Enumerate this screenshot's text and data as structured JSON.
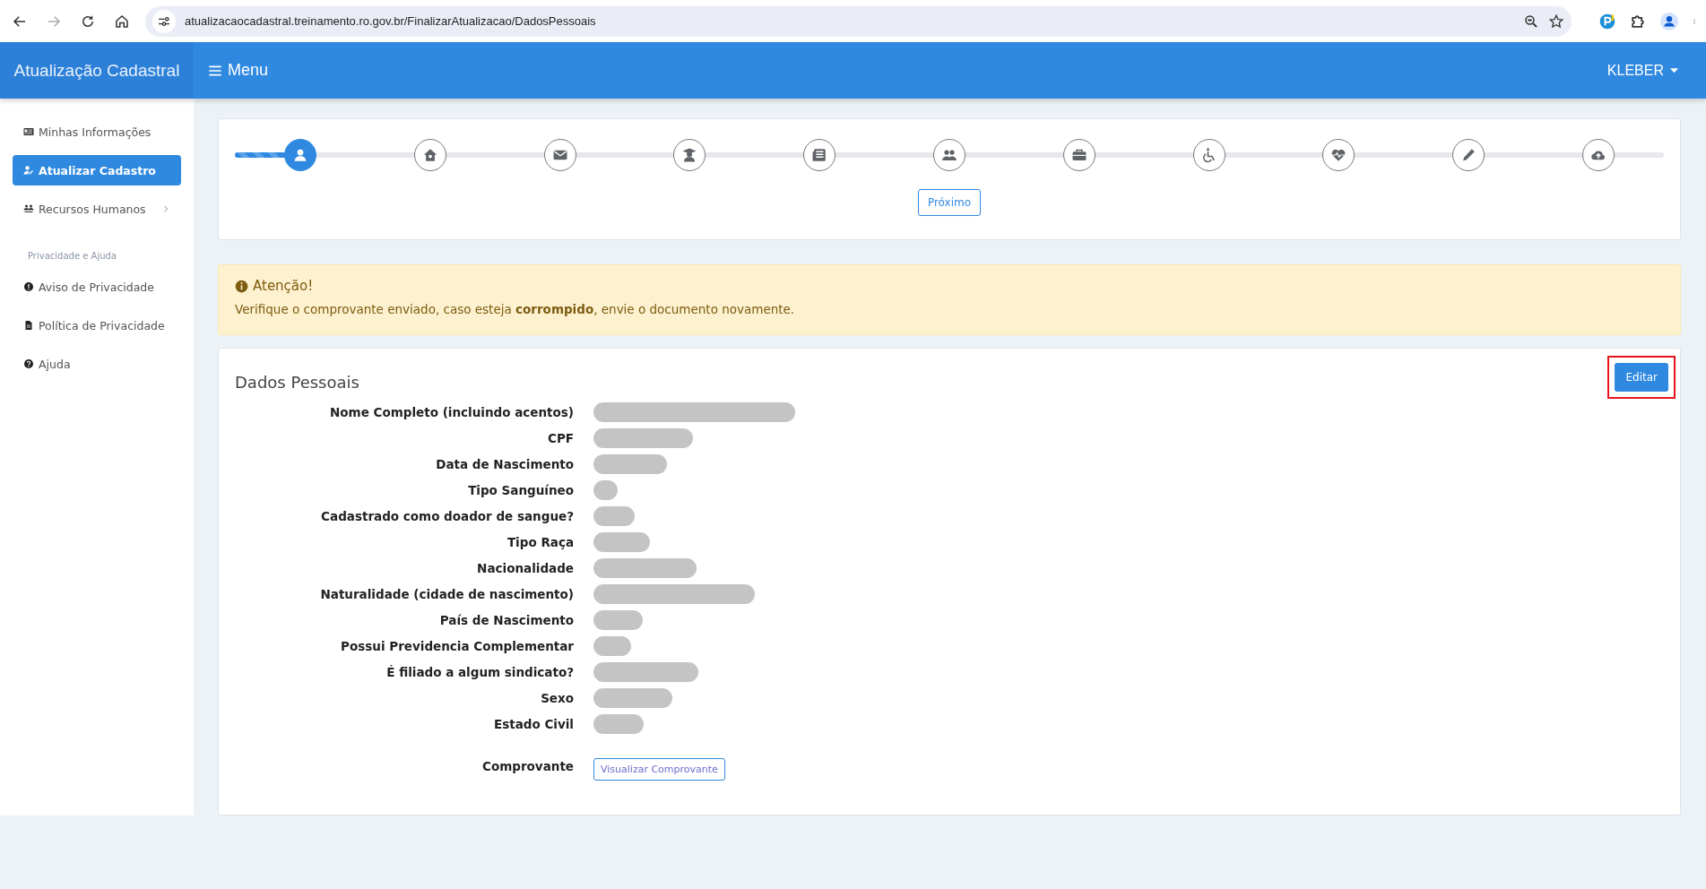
{
  "browser": {
    "url": "atualizacaocadastral.treinamento.ro.gov.br/FinalizarAtualizacao/DadosPessoais"
  },
  "header": {
    "brand": "Atualização Cadastral",
    "menu": "Menu",
    "user": "KLEBER"
  },
  "sidebar": {
    "items": [
      {
        "label": "Minhas Informações",
        "selected": false,
        "expandable": false
      },
      {
        "label": "Atualizar Cadastro",
        "selected": true,
        "expandable": false
      },
      {
        "label": "Recursos Humanos",
        "selected": false,
        "expandable": true
      }
    ],
    "section": "Privacidade e Ajuda",
    "section_items": [
      {
        "label": "Aviso de Privacidade"
      },
      {
        "label": "Política de Privacidade"
      },
      {
        "label": "Ajuda"
      }
    ]
  },
  "stepper": {
    "progress": {
      "level": 0.04
    },
    "steps": [
      {
        "selected": true
      },
      {
        "selected": false
      },
      {
        "selected": false
      },
      {
        "selected": false
      },
      {
        "selected": false
      },
      {
        "selected": false
      },
      {
        "selected": false
      },
      {
        "selected": false
      },
      {
        "selected": false
      },
      {
        "selected": false
      },
      {
        "selected": false
      }
    ],
    "next_button": "Próximo"
  },
  "alert": {
    "title": "Atenção!",
    "text": "Verifique o comprovante enviado, caso esteja **corrompido**, envie o documento novamente."
  },
  "card": {
    "title": "Dados Pessoais",
    "edit_button": {
      "label": "Editar",
      "highlighted": true
    },
    "fields": [
      {
        "label": "Nome Completo (incluindo acentos)",
        "redacted": true
      },
      {
        "label": "CPF",
        "redacted": true
      },
      {
        "label": "Data de Nascimento",
        "redacted": true
      },
      {
        "label": "Tipo Sanguíneo",
        "redacted": true
      },
      {
        "label": "Cadastrado como doador de sangue?",
        "redacted": true
      },
      {
        "label": "Tipo Raça",
        "redacted": true
      },
      {
        "label": "Nacionalidade",
        "redacted": true
      },
      {
        "label": "Naturalidade (cidade de nascimento)",
        "redacted": true
      },
      {
        "label": "País de Nascimento",
        "redacted": true
      },
      {
        "label": "Possui Previdencia Complementar",
        "redacted": true
      },
      {
        "label": "É filiado a algum sindicato?",
        "redacted": true
      },
      {
        "label": "Sexo",
        "redacted": true
      },
      {
        "label": "Estado Civil",
        "redacted": true
      }
    ],
    "receipt": {
      "label": "Comprovante",
      "button": "Visualizar Comprovante"
    }
  }
}
